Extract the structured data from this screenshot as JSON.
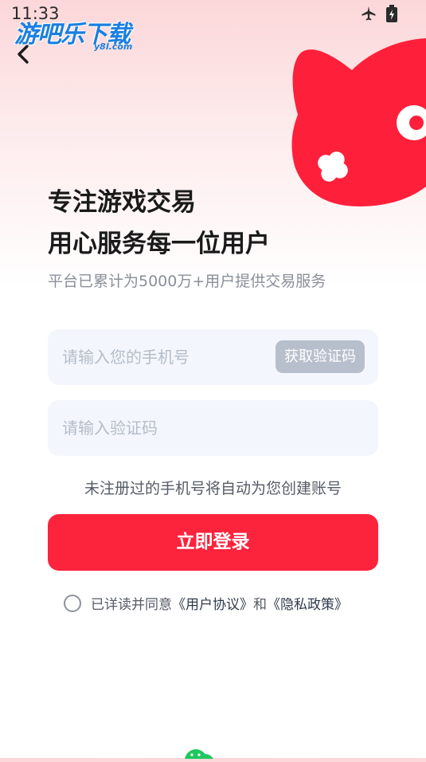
{
  "status_bar": {
    "time": "11:33",
    "icons": [
      "airplane-icon",
      "battery-icon"
    ]
  },
  "watermark": {
    "brand": "游吧乐下载",
    "domain": "y8l.com"
  },
  "header": {
    "back_icon": "chevron-left-icon"
  },
  "hero": {
    "headline_line1": "专注游戏交易",
    "headline_line2": "用心服务每一位用户",
    "subtitle": "平台已累计为5000万+用户提供交易服务"
  },
  "form": {
    "phone": {
      "placeholder": "请输入您的手机号",
      "value": ""
    },
    "get_code_label": "获取验证码",
    "code": {
      "placeholder": "请输入验证码",
      "value": ""
    },
    "hint": "未注册过的手机号将自动为您创建账号",
    "login_label": "立即登录"
  },
  "agreement": {
    "prefix": "已详读并同意",
    "user_agreement": "《用户协议》",
    "conjunction": "和",
    "privacy_policy": "《隐私政策》"
  },
  "colors": {
    "brand_red": "#fc233d",
    "mascot_red": "#fe1f3a",
    "input_bg": "#f3f7fd",
    "disabled_button": "#b8bfcc",
    "wechat_green": "#1fc75e"
  },
  "footer": {
    "icon": "wechat-icon"
  }
}
